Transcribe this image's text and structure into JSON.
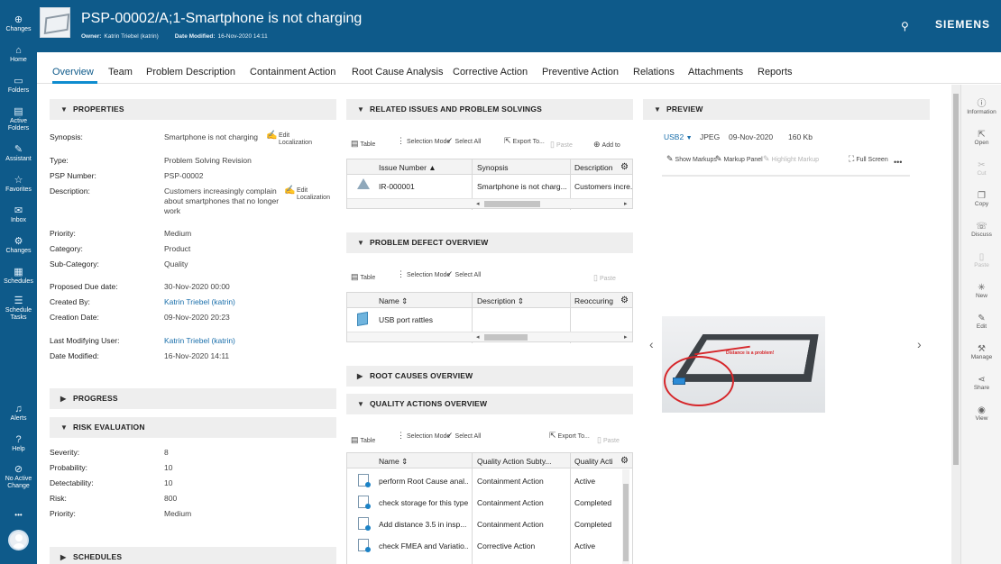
{
  "leftnav": {
    "items": [
      {
        "label": "Changes",
        "icon": "plus-circle-icon"
      },
      {
        "label": "Home",
        "icon": "home-icon"
      },
      {
        "label": "Folders",
        "icon": "folder-icon"
      },
      {
        "label": "Active Folders",
        "icon": "active-folder-icon"
      },
      {
        "label": "Assistant",
        "icon": "assistant-icon"
      },
      {
        "label": "Favorites",
        "icon": "star-icon"
      },
      {
        "label": "Inbox",
        "icon": "inbox-icon"
      },
      {
        "label": "Changes",
        "icon": "changes-icon"
      },
      {
        "label": "Schedules",
        "icon": "schedules-icon"
      },
      {
        "label": "Schedule Tasks",
        "icon": "schedule-tasks-icon"
      },
      {
        "label": "Alerts",
        "icon": "bell-icon"
      },
      {
        "label": "Help",
        "icon": "help-icon"
      },
      {
        "label": "No Active Change",
        "icon": "no-change-icon"
      }
    ],
    "more": "•••"
  },
  "header": {
    "title": "PSP-00002/A;1-Smartphone is not charging",
    "owner_key": "Owner:",
    "owner_value": "Katrin Triebel (katrin)",
    "modified_key": "Date Modified:",
    "modified_value": "16-Nov-2020 14:11",
    "brand": "SIEMENS"
  },
  "tabs": [
    "Overview",
    "Team",
    "Problem Description",
    "Containment Action",
    "Root Cause Analysis",
    "Corrective Action",
    "Preventive Action",
    "Relations",
    "Attachments",
    "Reports"
  ],
  "properties": {
    "heading": "PROPERTIES",
    "synopsis_label": "Synopsis:",
    "synopsis_value": "Smartphone is not charging",
    "edit_localization": "Edit Localization",
    "type_label": "Type:",
    "type_value": "Problem Solving Revision",
    "psp_label": "PSP Number:",
    "psp_value": "PSP-00002",
    "description_label": "Description:",
    "description_value": "Customers increasingly complain about smartphones that no longer work",
    "priority_label": "Priority:",
    "priority_value": "Medium",
    "category_label": "Category:",
    "category_value": "Product",
    "subcategory_label": "Sub-Category:",
    "subcategory_value": "Quality",
    "due_label": "Proposed Due date:",
    "due_value": "30-Nov-2020 00:00",
    "createdby_label": "Created By:",
    "createdby_value": "Katrin Triebel (katrin)",
    "creation_label": "Creation Date:",
    "creation_value": "09-Nov-2020 20:23",
    "lastmod_label": "Last Modifying User:",
    "lastmod_value": "Katrin Triebel (katrin)",
    "datemod_label": "Date Modified:",
    "datemod_value": "16-Nov-2020 14:11"
  },
  "progress": {
    "heading": "PROGRESS"
  },
  "risk": {
    "heading": "RISK EVALUATION",
    "severity_label": "Severity:",
    "severity_value": "8",
    "probability_label": "Probability:",
    "probability_value": "10",
    "detectability_label": "Detectability:",
    "detectability_value": "10",
    "risk_label": "Risk:",
    "risk_value": "800",
    "priority_label": "Priority:",
    "priority_value": "Medium"
  },
  "schedules": {
    "heading": "SCHEDULES"
  },
  "toolbar": {
    "table": "Table",
    "selection_mode": "Selection Mode",
    "select_all": "Select All",
    "export_to": "Export To...",
    "paste": "Paste",
    "add_to": "Add to"
  },
  "related": {
    "heading": "RELATED ISSUES AND PROBLEM SOLVINGS",
    "columns": [
      "Issue Number",
      "Synopsis",
      "Description"
    ],
    "rows": [
      [
        "IR-000001",
        "Smartphone is not charg...",
        "Customers incre..."
      ]
    ]
  },
  "defects": {
    "heading": "PROBLEM DEFECT OVERVIEW",
    "columns": [
      "Name",
      "Description",
      "Reoccuring"
    ],
    "rows": [
      [
        "USB port rattles",
        "",
        ""
      ]
    ]
  },
  "rootcauses": {
    "heading": "ROOT CAUSES OVERVIEW"
  },
  "quality": {
    "heading": "QUALITY ACTIONS OVERVIEW",
    "columns": [
      "Name",
      "Quality Action Subty...",
      "Quality Acti"
    ],
    "rows": [
      [
        "perform Root Cause anal...",
        "Containment Action",
        "Active"
      ],
      [
        "check storage for this type",
        "Containment Action",
        "Completed"
      ],
      [
        "Add distance 3.5 in insp...",
        "Containment Action",
        "Completed"
      ],
      [
        "check FMEA and Variatio...",
        "Corrective Action",
        "Active"
      ]
    ]
  },
  "preview": {
    "heading": "PREVIEW",
    "file": "USB2",
    "format": "JPEG",
    "date": "09-Nov-2020",
    "size": "160 Kb",
    "show_markups": "Show Markups",
    "markup_panel": "Markup Panel",
    "highlight_markup": "Highlight Markup",
    "full_screen": "Full Screen",
    "more": "•••",
    "image_note": "Distance is a problem!"
  },
  "rightrail": [
    {
      "label": "Information",
      "icon": "info-icon",
      "enabled": true
    },
    {
      "label": "Open",
      "icon": "open-icon",
      "enabled": true
    },
    {
      "label": "Cut",
      "icon": "scissors-icon",
      "enabled": false
    },
    {
      "label": "Copy",
      "icon": "copy-icon",
      "enabled": true
    },
    {
      "label": "Discuss",
      "icon": "discuss-icon",
      "enabled": true
    },
    {
      "label": "Paste",
      "icon": "paste-icon",
      "enabled": false
    },
    {
      "label": "New",
      "icon": "new-icon",
      "enabled": true
    },
    {
      "label": "Edit",
      "icon": "pencil-icon",
      "enabled": true
    },
    {
      "label": "Manage",
      "icon": "manage-icon",
      "enabled": true
    },
    {
      "label": "Share",
      "icon": "share-icon",
      "enabled": true
    },
    {
      "label": "View",
      "icon": "eye-icon",
      "enabled": true
    }
  ],
  "colors": {
    "brand_blue": "#0e5a8a",
    "accent": "#0e8ccf",
    "link": "#1a6fab"
  }
}
